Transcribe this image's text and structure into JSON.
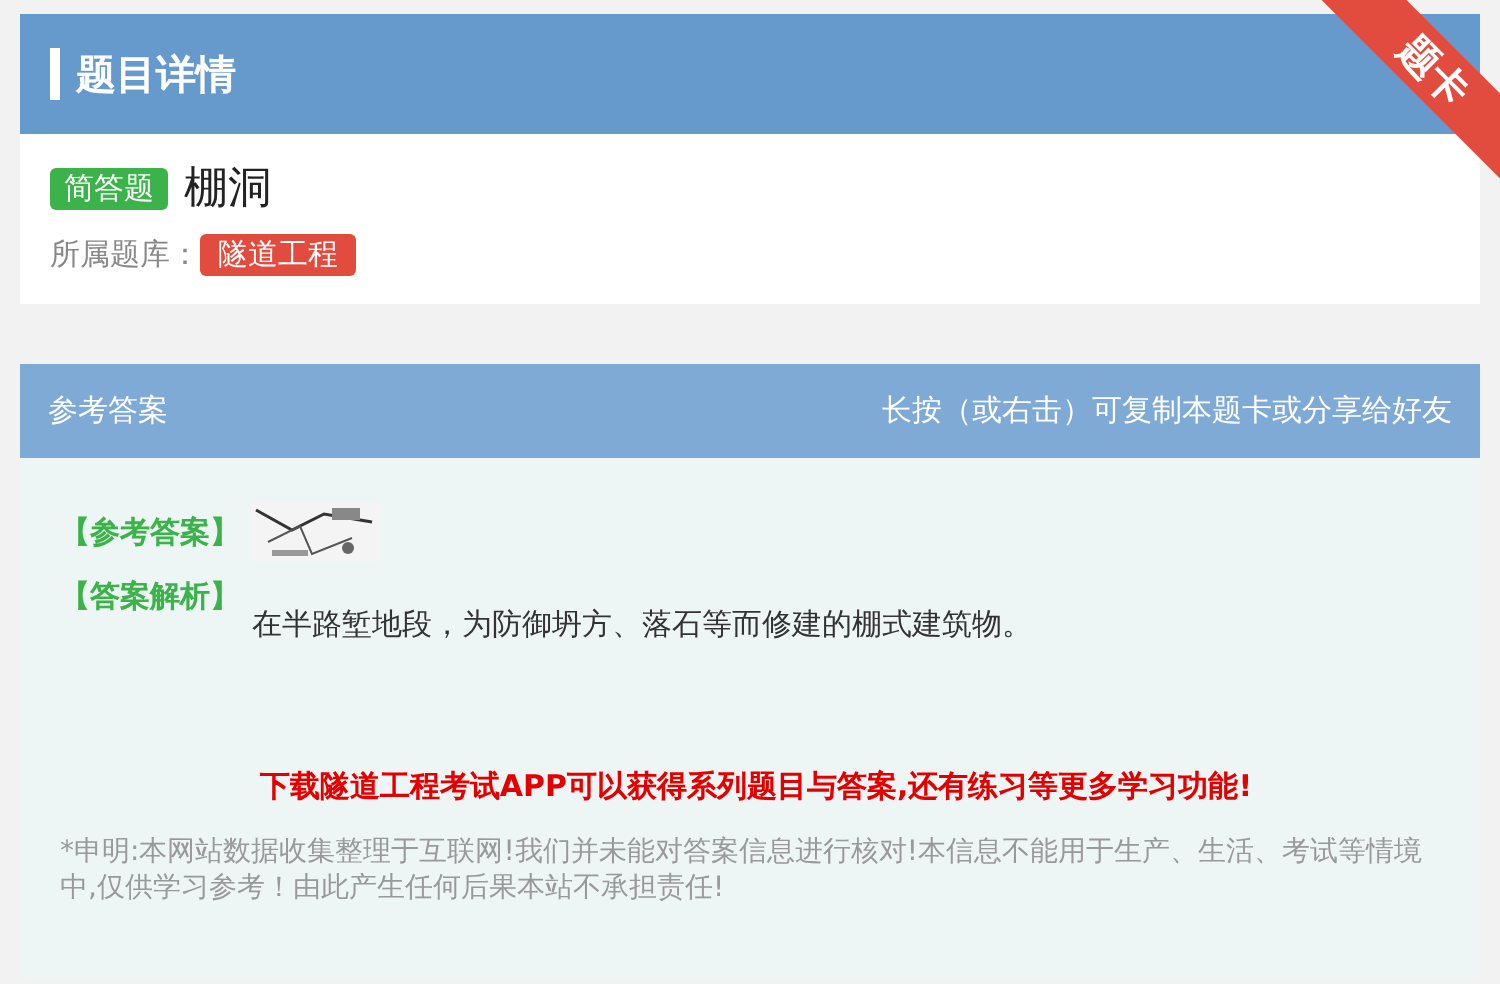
{
  "header": {
    "title": "题目详情",
    "ribbon": "题卡"
  },
  "question": {
    "type_badge": "简答题",
    "title": "棚洞",
    "bank_label": "所属题库：",
    "bank": "隧道工程"
  },
  "answer_panel": {
    "title": "参考答案",
    "hint": "长按（或右击）可复制本题卡或分享给好友",
    "answer_label": "【参考答案】",
    "analysis_label": "【答案解析】",
    "analysis": "在半路堑地段，为防御坍方、落石等而修建的棚式建筑物。",
    "promo": "下载隧道工程考试APP可以获得系列题目与答案,还有练习等更多学习功能!",
    "disclaimer": "*申明:本网站数据收集整理于互联网!我们并未能对答案信息进行核对!本信息不能用于生产、生活、考试等情境中,仅供学习参考！由此产生任何后果本站不承担责任!"
  }
}
